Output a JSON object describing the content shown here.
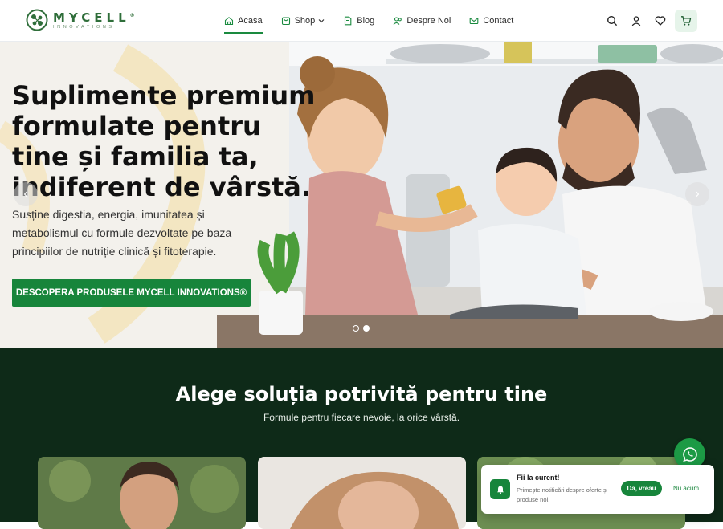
{
  "brand": {
    "name": "MYCELL",
    "sub": "INNOVATIONS",
    "reg": "®",
    "accent": "#17853b",
    "dark_section": "#0e2a18"
  },
  "nav": {
    "items": [
      {
        "label": "Acasa",
        "icon": "home-icon"
      },
      {
        "label": "Shop",
        "icon": "bag-icon"
      },
      {
        "label": "Blog",
        "icon": "document-icon"
      },
      {
        "label": "Despre Noi",
        "icon": "users-icon"
      },
      {
        "label": "Contact",
        "icon": "mail-icon"
      }
    ]
  },
  "actions": {
    "icons": [
      "search-icon",
      "user-icon",
      "heart-icon",
      "cart-icon"
    ]
  },
  "hero": {
    "title": "Suplimente premium formulate pentru tine și familia ta, indiferent de vârstă.",
    "subtitle": "Susține digestia, energia, imunitatea și metabolismul cu formule dezvoltate pe baza principiilor de nutriție clinică și fitoterapie.",
    "cta": "DESCOPERA PRODUSELE MYCELL INNOVATIONS®",
    "prev": "‹",
    "next": "›"
  },
  "section": {
    "title": "Alege soluția potrivită pentru tine",
    "subtitle": "Formule pentru fiecare nevoie, la orice vârstă."
  },
  "notification": {
    "title": "Fii la curent!",
    "text": "Primește notificări despre oferte și produse noi.",
    "yes": "Da, vreau",
    "no": "Nu acum"
  }
}
